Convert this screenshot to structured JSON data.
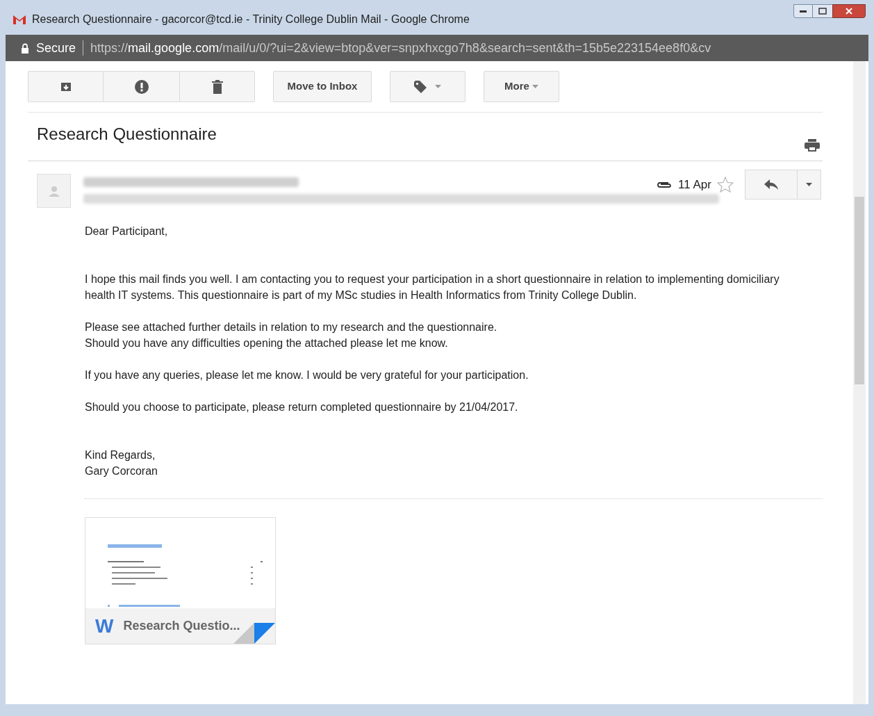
{
  "window": {
    "title": "Research Questionnaire - gacorcor@tcd.ie - Trinity College Dublin Mail - Google Chrome"
  },
  "address_bar": {
    "security": "Secure",
    "url_scheme": "https://",
    "url_host": "mail.google.com",
    "url_path": "/mail/u/0/?ui=2&view=btop&ver=snpxhxcgo7h8&search=sent&th=15b5e223154ee8f0&cv"
  },
  "toolbar": {
    "move_button": "Move to Inbox",
    "more_button": "More"
  },
  "subject": "Research Questionnaire",
  "message": {
    "date": "11 Apr",
    "starred": false,
    "has_attachment": true,
    "body": [
      "Dear Participant,",
      "I hope this mail finds you well. I am contacting you to request your participation in a short questionnaire in relation to implementing domiciliary health IT systems. This questionnaire is part of my MSc studies in Health Informatics from Trinity College Dublin.",
      "Please see attached further details in relation to my research and the questionnaire.\nShould you have any difficulties opening the attached please let me know.",
      "If you have any queries, please let me know. I would be very grateful for your participation.",
      "Should you choose to participate, please return completed questionnaire by 21/04/2017.",
      "Kind Regards,\nGary Corcoran"
    ]
  },
  "attachment": {
    "badge": "W",
    "name": "Research Questio..."
  }
}
